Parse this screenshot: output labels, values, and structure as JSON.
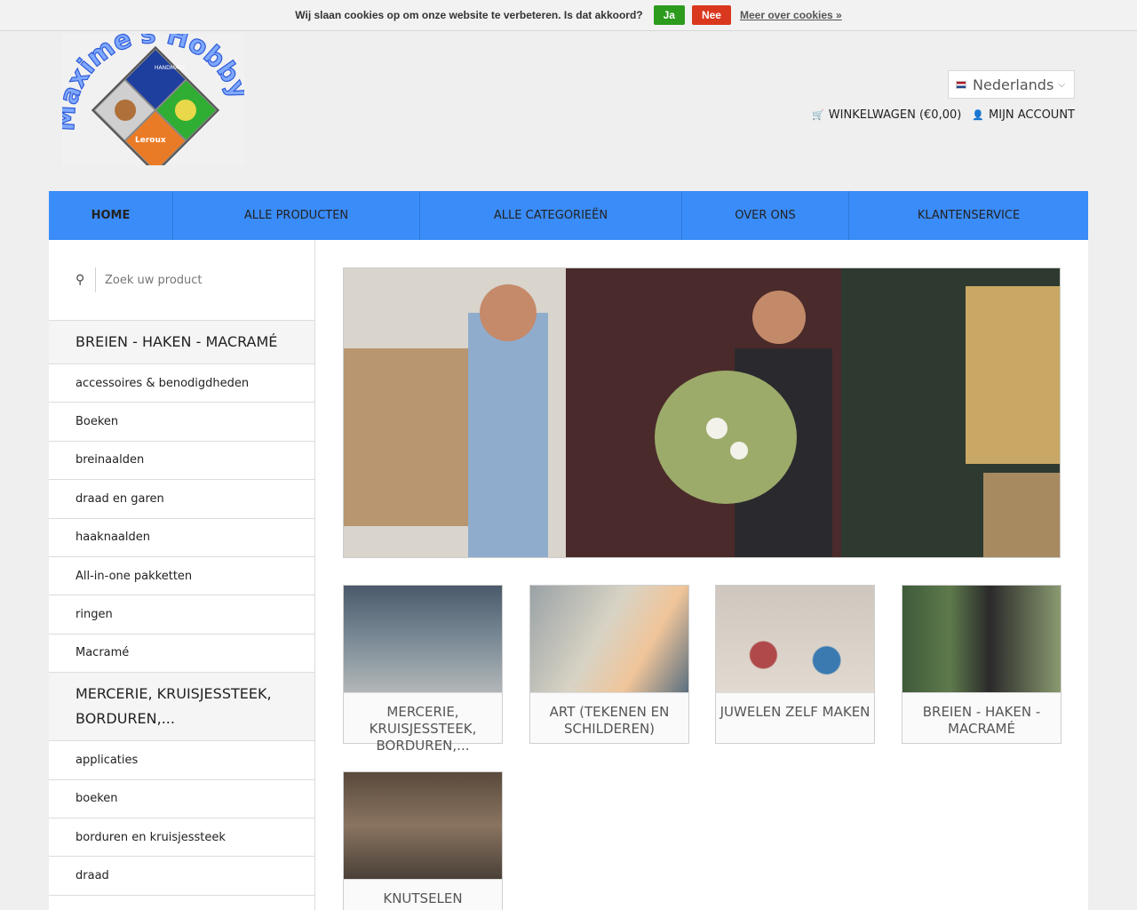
{
  "cookie": {
    "message": "Wij slaan cookies op om onze website te verbeteren. Is dat akkoord?",
    "yes_label": "Ja",
    "no_label": "Nee",
    "more_label": "Meer over cookies »"
  },
  "header": {
    "logo_text_top": "Maxime's Hobby",
    "logo_badge_handmade": "HANDMADE",
    "logo_badge_leroux": "Leroux",
    "language": "Nederlands",
    "cart_label": "WINKELWAGEN (€0,00)",
    "account_label": "MIJN ACCOUNT"
  },
  "nav": {
    "items": [
      {
        "label": "HOME",
        "active": true
      },
      {
        "label": "ALLE PRODUCTEN"
      },
      {
        "label": "ALLE CATEGORIEËN"
      },
      {
        "label": "OVER ONS"
      },
      {
        "label": "KLANTENSERVICE"
      }
    ]
  },
  "search": {
    "placeholder": "Zoek uw product"
  },
  "sidebar": {
    "cat1_title": "BREIEN - HAKEN - MACRAMÉ",
    "cat1_items": [
      "accessoires & benodigdheden",
      "Boeken",
      "breinaalden",
      "draad en garen",
      "haaknaalden",
      "All-in-one pakketten",
      "ringen",
      "Macramé"
    ],
    "cat2_title": "MERCERIE, KRUISJESSTEEK, BORDUREN,...",
    "cat2_items": [
      "applicaties",
      "boeken",
      "borduren en kruisjessteek",
      "draad"
    ]
  },
  "tiles": [
    {
      "label": "MERCERIE, KRUISJESSTEEK, BORDUREN,..."
    },
    {
      "label": "ART (TEKENEN EN SCHILDEREN)"
    },
    {
      "label": "JUWELEN ZELF MAKEN"
    },
    {
      "label": "BREIEN - HAKEN - MACRAMÉ"
    },
    {
      "label": "KNUTSELEN"
    }
  ],
  "colors": {
    "nav": "#3a8cf8",
    "yes": "#2c9b1e",
    "no": "#d9381e"
  }
}
